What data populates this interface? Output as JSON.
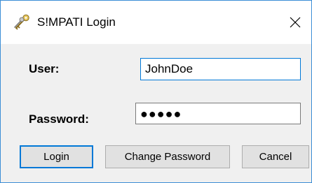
{
  "window": {
    "title": "S!MPATI Login",
    "close_glyph": "✕",
    "icon": "keys-icon"
  },
  "form": {
    "user_label": "User:",
    "user_value": "JohnDoe",
    "password_label": "Password:",
    "password_mask": "●●●●●"
  },
  "buttons": {
    "login": "Login",
    "change_password": "Change Password",
    "cancel": "Cancel"
  },
  "colors": {
    "accent": "#0078d7",
    "window_border": "#3c8ed6",
    "button_face": "#e1e1e1"
  }
}
